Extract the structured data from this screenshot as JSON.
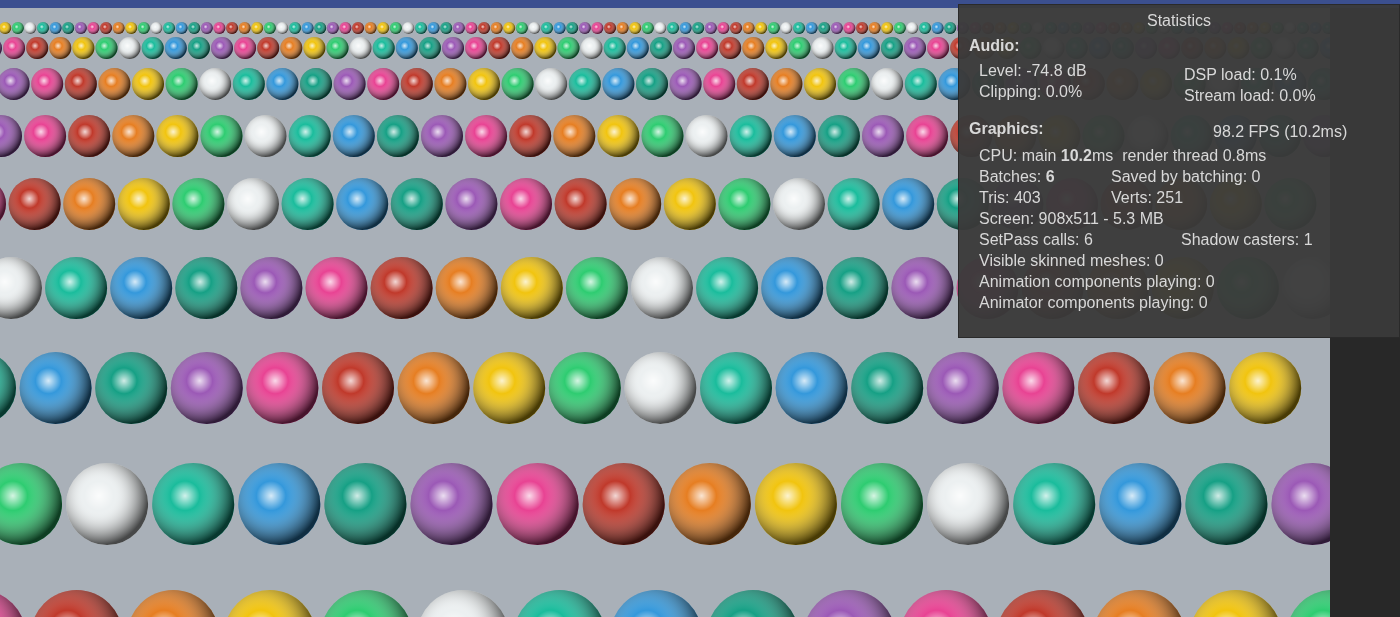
{
  "statistics": {
    "title": "Statistics",
    "audio": {
      "heading": "Audio:",
      "left": [
        "Level: -74.8 dB",
        "Clipping: 0.0%"
      ],
      "right": [
        "DSP load: 0.1%",
        "Stream load: 0.0%"
      ]
    },
    "graphics": {
      "heading": "Graphics:",
      "fps": "98.2 FPS (10.2ms)",
      "rows": [
        {
          "kind": "single",
          "cells": [
            "CPU: main **10.2**ms  render thread 0.8ms"
          ]
        },
        {
          "kind": "pair",
          "cells": [
            "Batches: **6**",
            "Saved by batching: 0"
          ]
        },
        {
          "kind": "pair",
          "cells": [
            "Tris: 403",
            "Verts: 251"
          ]
        },
        {
          "kind": "single",
          "cells": [
            "Screen: 908x511 - 5.3 MB"
          ]
        },
        {
          "kind": "wide",
          "cells": [
            "SetPass calls: 6",
            "Shadow casters: 1"
          ]
        },
        {
          "kind": "single",
          "cells": [
            "Visible skinned meshes: 0"
          ]
        },
        {
          "kind": "single",
          "cells": [
            "Animation components playing: 0"
          ]
        },
        {
          "kind": "single",
          "cells": [
            "Animator components playing: 0"
          ]
        }
      ]
    }
  }
}
